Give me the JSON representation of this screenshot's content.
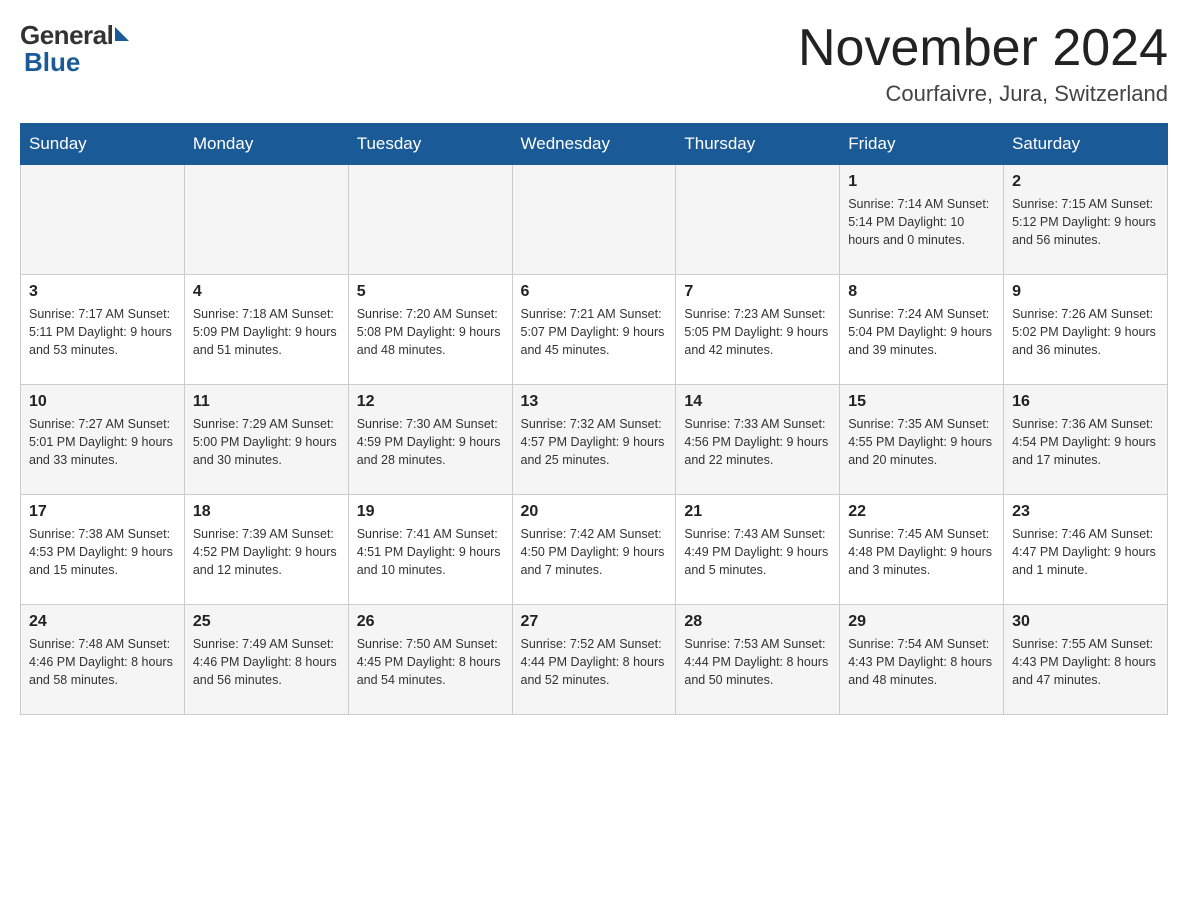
{
  "header": {
    "logo_general": "General",
    "logo_blue": "Blue",
    "month_title": "November 2024",
    "location": "Courfaivre, Jura, Switzerland"
  },
  "days_of_week": [
    "Sunday",
    "Monday",
    "Tuesday",
    "Wednesday",
    "Thursday",
    "Friday",
    "Saturday"
  ],
  "weeks": [
    [
      {
        "day": "",
        "info": ""
      },
      {
        "day": "",
        "info": ""
      },
      {
        "day": "",
        "info": ""
      },
      {
        "day": "",
        "info": ""
      },
      {
        "day": "",
        "info": ""
      },
      {
        "day": "1",
        "info": "Sunrise: 7:14 AM\nSunset: 5:14 PM\nDaylight: 10 hours and 0 minutes."
      },
      {
        "day": "2",
        "info": "Sunrise: 7:15 AM\nSunset: 5:12 PM\nDaylight: 9 hours and 56 minutes."
      }
    ],
    [
      {
        "day": "3",
        "info": "Sunrise: 7:17 AM\nSunset: 5:11 PM\nDaylight: 9 hours and 53 minutes."
      },
      {
        "day": "4",
        "info": "Sunrise: 7:18 AM\nSunset: 5:09 PM\nDaylight: 9 hours and 51 minutes."
      },
      {
        "day": "5",
        "info": "Sunrise: 7:20 AM\nSunset: 5:08 PM\nDaylight: 9 hours and 48 minutes."
      },
      {
        "day": "6",
        "info": "Sunrise: 7:21 AM\nSunset: 5:07 PM\nDaylight: 9 hours and 45 minutes."
      },
      {
        "day": "7",
        "info": "Sunrise: 7:23 AM\nSunset: 5:05 PM\nDaylight: 9 hours and 42 minutes."
      },
      {
        "day": "8",
        "info": "Sunrise: 7:24 AM\nSunset: 5:04 PM\nDaylight: 9 hours and 39 minutes."
      },
      {
        "day": "9",
        "info": "Sunrise: 7:26 AM\nSunset: 5:02 PM\nDaylight: 9 hours and 36 minutes."
      }
    ],
    [
      {
        "day": "10",
        "info": "Sunrise: 7:27 AM\nSunset: 5:01 PM\nDaylight: 9 hours and 33 minutes."
      },
      {
        "day": "11",
        "info": "Sunrise: 7:29 AM\nSunset: 5:00 PM\nDaylight: 9 hours and 30 minutes."
      },
      {
        "day": "12",
        "info": "Sunrise: 7:30 AM\nSunset: 4:59 PM\nDaylight: 9 hours and 28 minutes."
      },
      {
        "day": "13",
        "info": "Sunrise: 7:32 AM\nSunset: 4:57 PM\nDaylight: 9 hours and 25 minutes."
      },
      {
        "day": "14",
        "info": "Sunrise: 7:33 AM\nSunset: 4:56 PM\nDaylight: 9 hours and 22 minutes."
      },
      {
        "day": "15",
        "info": "Sunrise: 7:35 AM\nSunset: 4:55 PM\nDaylight: 9 hours and 20 minutes."
      },
      {
        "day": "16",
        "info": "Sunrise: 7:36 AM\nSunset: 4:54 PM\nDaylight: 9 hours and 17 minutes."
      }
    ],
    [
      {
        "day": "17",
        "info": "Sunrise: 7:38 AM\nSunset: 4:53 PM\nDaylight: 9 hours and 15 minutes."
      },
      {
        "day": "18",
        "info": "Sunrise: 7:39 AM\nSunset: 4:52 PM\nDaylight: 9 hours and 12 minutes."
      },
      {
        "day": "19",
        "info": "Sunrise: 7:41 AM\nSunset: 4:51 PM\nDaylight: 9 hours and 10 minutes."
      },
      {
        "day": "20",
        "info": "Sunrise: 7:42 AM\nSunset: 4:50 PM\nDaylight: 9 hours and 7 minutes."
      },
      {
        "day": "21",
        "info": "Sunrise: 7:43 AM\nSunset: 4:49 PM\nDaylight: 9 hours and 5 minutes."
      },
      {
        "day": "22",
        "info": "Sunrise: 7:45 AM\nSunset: 4:48 PM\nDaylight: 9 hours and 3 minutes."
      },
      {
        "day": "23",
        "info": "Sunrise: 7:46 AM\nSunset: 4:47 PM\nDaylight: 9 hours and 1 minute."
      }
    ],
    [
      {
        "day": "24",
        "info": "Sunrise: 7:48 AM\nSunset: 4:46 PM\nDaylight: 8 hours and 58 minutes."
      },
      {
        "day": "25",
        "info": "Sunrise: 7:49 AM\nSunset: 4:46 PM\nDaylight: 8 hours and 56 minutes."
      },
      {
        "day": "26",
        "info": "Sunrise: 7:50 AM\nSunset: 4:45 PM\nDaylight: 8 hours and 54 minutes."
      },
      {
        "day": "27",
        "info": "Sunrise: 7:52 AM\nSunset: 4:44 PM\nDaylight: 8 hours and 52 minutes."
      },
      {
        "day": "28",
        "info": "Sunrise: 7:53 AM\nSunset: 4:44 PM\nDaylight: 8 hours and 50 minutes."
      },
      {
        "day": "29",
        "info": "Sunrise: 7:54 AM\nSunset: 4:43 PM\nDaylight: 8 hours and 48 minutes."
      },
      {
        "day": "30",
        "info": "Sunrise: 7:55 AM\nSunset: 4:43 PM\nDaylight: 8 hours and 47 minutes."
      }
    ]
  ]
}
